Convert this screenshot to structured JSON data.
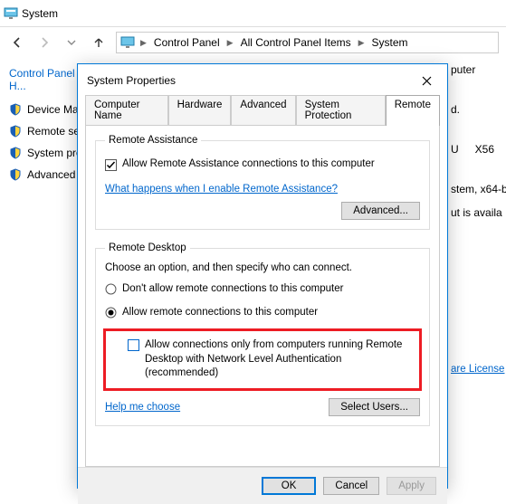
{
  "window": {
    "app_title": "System"
  },
  "nav": {
    "breadcrumbs": {
      "b0": "Control Panel",
      "b1": "All Control Panel Items",
      "b2": "System"
    }
  },
  "sidebar": {
    "home": "Control Panel H...",
    "items": {
      "i0": "Device Ma...",
      "i1": "Remote se...",
      "i2": "System pro...",
      "i3": "Advanced ..."
    }
  },
  "right": {
    "r0": "puter",
    "r1": "d.",
    "r2": "U",
    "r3": "X56",
    "r4": "stem, x64-b",
    "r5": "ut is availa",
    "r6": "are License"
  },
  "dialog": {
    "title": "System Properties",
    "tabs": {
      "t0": "Computer Name",
      "t1": "Hardware",
      "t2": "Advanced",
      "t3": "System Protection",
      "t4": "Remote"
    },
    "ra": {
      "legend": "Remote Assistance",
      "allow_label": "Allow Remote Assistance connections to this computer",
      "allow_checked": true,
      "help_link": "What happens when I enable Remote Assistance?",
      "advanced_btn": "Advanced..."
    },
    "rd": {
      "legend": "Remote Desktop",
      "note": "Choose an option, and then specify who can connect.",
      "opt0": "Don't allow remote connections to this computer",
      "opt1": "Allow remote connections to this computer",
      "selected": 1,
      "nla_label": "Allow connections only from computers running Remote Desktop with Network Level Authentication (recommended)",
      "nla_checked": false,
      "help_link": "Help me choose",
      "select_users_btn": "Select Users..."
    },
    "buttons": {
      "ok": "OK",
      "cancel": "Cancel",
      "apply": "Apply"
    }
  }
}
